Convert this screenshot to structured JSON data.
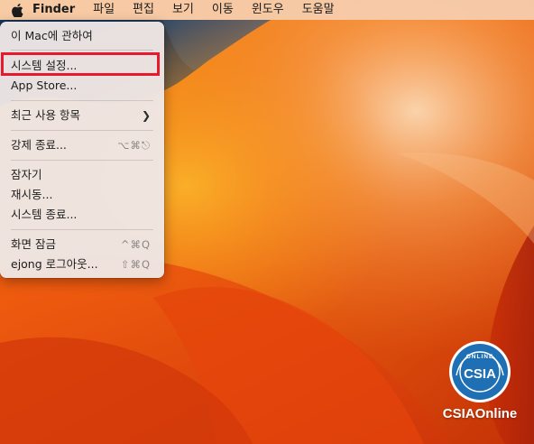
{
  "menubar": {
    "app_name": "Finder",
    "items": [
      "파일",
      "편집",
      "보기",
      "이동",
      "윈도우",
      "도움말"
    ]
  },
  "apple_menu": {
    "about": "이 Mac에 관하여",
    "system_settings": "시스템 설정...",
    "app_store": "App Store...",
    "recent_items": "최근 사용 항목",
    "force_quit": "강제 종료...",
    "force_quit_shortcut": "⌥⌘⎋",
    "sleep": "잠자기",
    "restart": "재시동...",
    "shutdown": "시스템 종료...",
    "lock_screen": "화면 잠금",
    "lock_screen_shortcut": "^⌘Q",
    "logout": "ejong 로그아웃...",
    "logout_shortcut": "⇧⌘Q"
  },
  "logo": {
    "ring_text": "ONLINE",
    "mark_text": "CSIA",
    "caption": "CSIAOnline"
  },
  "colors": {
    "highlight_border": "#e8192c",
    "logo_blue": "#1f6fb5",
    "wallpaper_orange": "#f26a0c",
    "wallpaper_dark": "#123456"
  }
}
